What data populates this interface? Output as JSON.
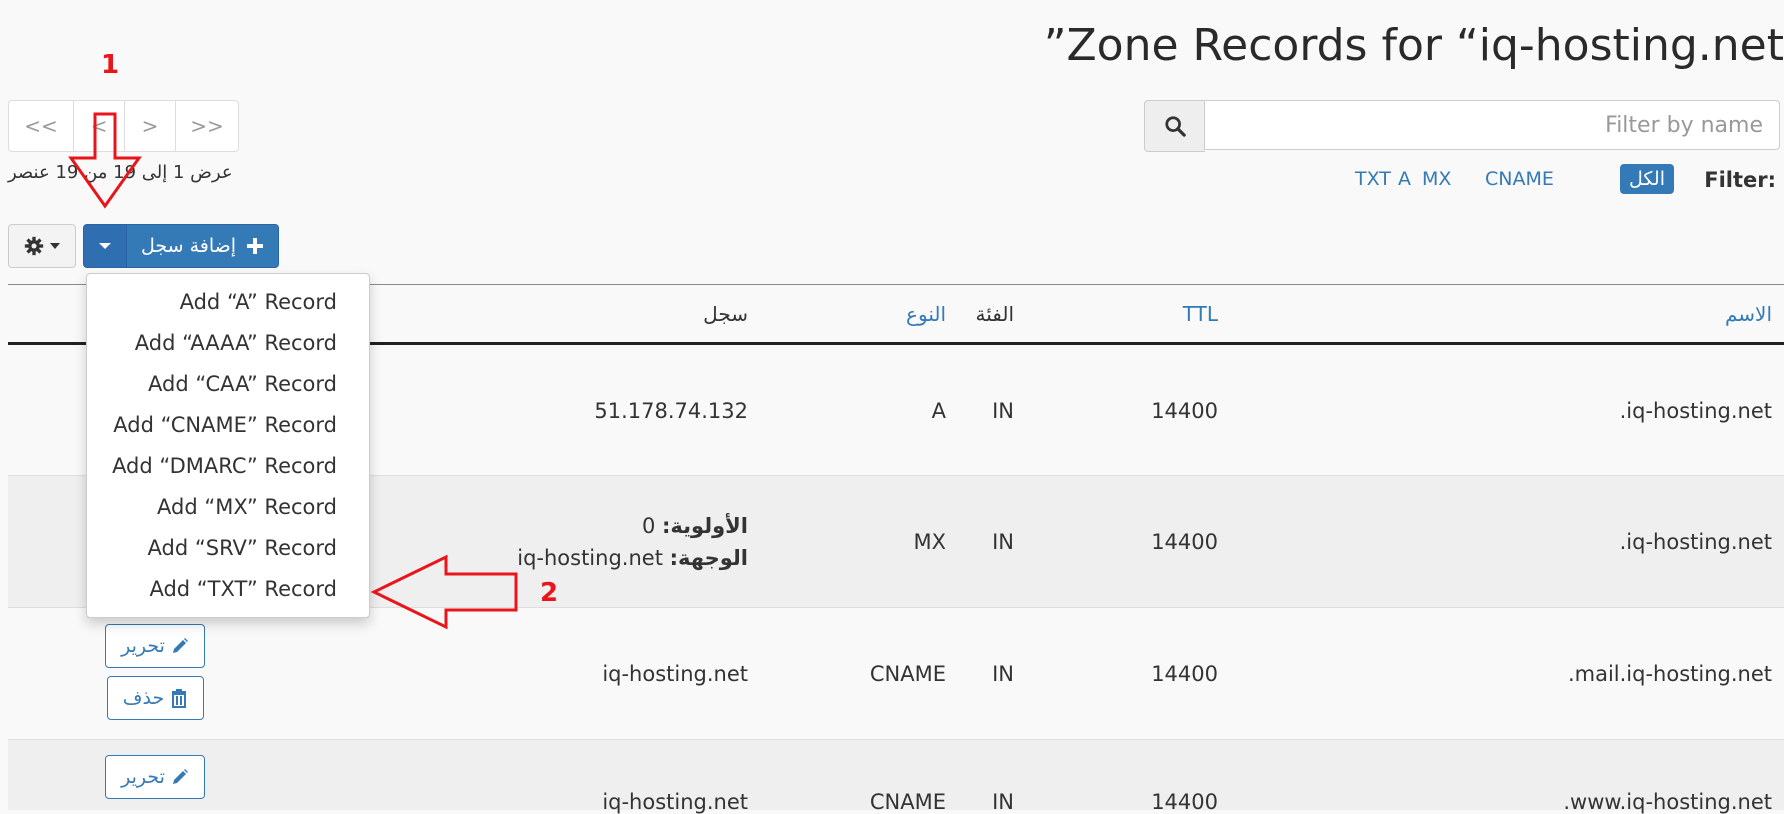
{
  "title": "”Zone Records for “iq-hosting.net",
  "search": {
    "placeholder": "Filter by name",
    "icon": "search-icon"
  },
  "filter": {
    "label": "Filter:",
    "items": [
      {
        "label": "الكل",
        "active": true
      },
      {
        "label": "A",
        "active": false
      },
      {
        "label": "CNAME",
        "active": false
      },
      {
        "label": "MX",
        "active": false
      },
      {
        "label": "TXT",
        "active": false
      }
    ]
  },
  "pagination": {
    "first": "<<",
    "prev": "<",
    "next": ">",
    "last": ">>",
    "info": "عرض 1 إلى 19 من 19 عنصر"
  },
  "toolbar": {
    "add_label": "إضافة سجل",
    "settings_icon": "gear-icon"
  },
  "table": {
    "headers": {
      "name": "الاسم",
      "ttl": "TTL",
      "class": "الفئة",
      "type": "النوع",
      "record": "سجل"
    },
    "rows": [
      {
        "name": ".iq-hosting.net",
        "ttl": "14400",
        "class": "IN",
        "type": "A",
        "record": "51.178.74.132"
      },
      {
        "name": ".iq-hosting.net",
        "ttl": "14400",
        "class": "IN",
        "type": "MX",
        "priority_label": "الأولوية:",
        "priority_value": "0",
        "destination_label": "الوجهة:",
        "destination_value": "iq-hosting.net"
      },
      {
        "name": ".mail.iq-hosting.net",
        "ttl": "14400",
        "class": "IN",
        "type": "CNAME",
        "record": "iq-hosting.net"
      },
      {
        "name": ".www.iq-hosting.net",
        "ttl": "14400",
        "class": "IN",
        "type": "CNAME",
        "record": "iq-hosting.net"
      }
    ],
    "edit_label": "تحرير",
    "delete_label": "حذف"
  },
  "add_menu": {
    "items": [
      "Add “A” Record",
      "Add “AAAA” Record",
      "Add “CAA” Record",
      "Add “CNAME” Record",
      "Add “DMARC” Record",
      "Add “MX” Record",
      "Add “SRV” Record",
      "Add “TXT” Record"
    ]
  },
  "annotations": {
    "step1": "1",
    "step2": "2"
  },
  "colors": {
    "accent": "#337ab7",
    "annotation": "#e8161b"
  }
}
